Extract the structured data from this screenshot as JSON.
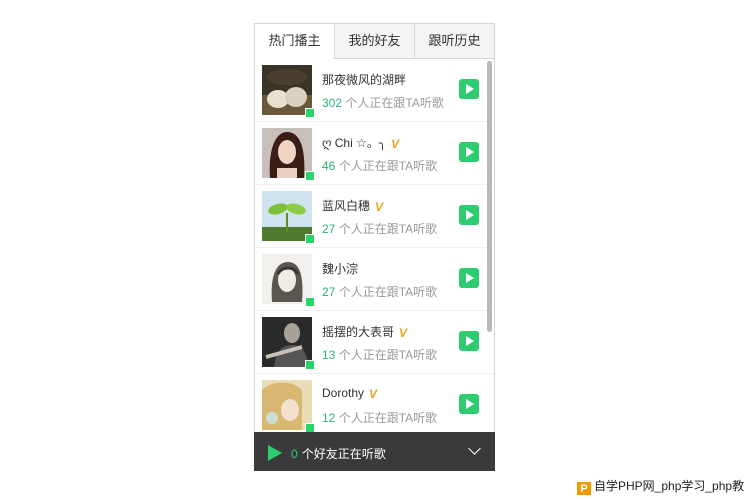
{
  "tabs": [
    {
      "label": "热门播主",
      "active": true
    },
    {
      "label": "我的好友",
      "active": false
    },
    {
      "label": "跟听历史",
      "active": false
    }
  ],
  "listeners_suffix": "个人正在跟TA听歌",
  "vip_badge": "V",
  "items": [
    {
      "name": "那夜微风的湖畔",
      "count": "302",
      "vip": false,
      "avatar": "hands-photo"
    },
    {
      "name": "ღ Chi ☆。╮",
      "count": "46",
      "vip": true,
      "avatar": "girl-photo"
    },
    {
      "name": "蓝风白穗",
      "count": "27",
      "vip": true,
      "avatar": "sprout-photo"
    },
    {
      "name": "魏小淙",
      "count": "27",
      "vip": false,
      "avatar": "sketch-girl"
    },
    {
      "name": "摇摆的大表哥",
      "count": "13",
      "vip": true,
      "avatar": "guitar-photo"
    },
    {
      "name": "Dorothy",
      "count": "12",
      "vip": true,
      "avatar": "blonde-photo"
    }
  ],
  "footer": {
    "count": "0",
    "text": "个好友正在听歌"
  },
  "watermark": {
    "logo": "P",
    "text": "自学PHP网_php学习_php教"
  },
  "colors": {
    "accent": "#2ecc71",
    "online": "#2bd36b",
    "vip": "#e7a51a",
    "footer_bg": "#3a3a3a"
  }
}
